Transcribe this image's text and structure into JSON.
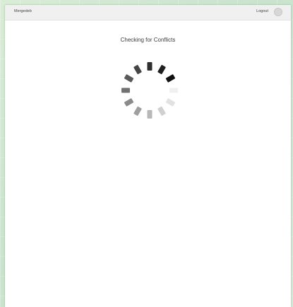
{
  "header": {
    "app_name": "Mergedeb",
    "logout_label": "Logout"
  },
  "main": {
    "title": "Checking for Conflicts"
  },
  "spinner": {
    "icon": "loading-spinner-icon",
    "segments": 12
  },
  "colors": {
    "page_background": "#cfe6d2",
    "panel_background": "#ffffff",
    "header_background": "#f0f0f0"
  }
}
